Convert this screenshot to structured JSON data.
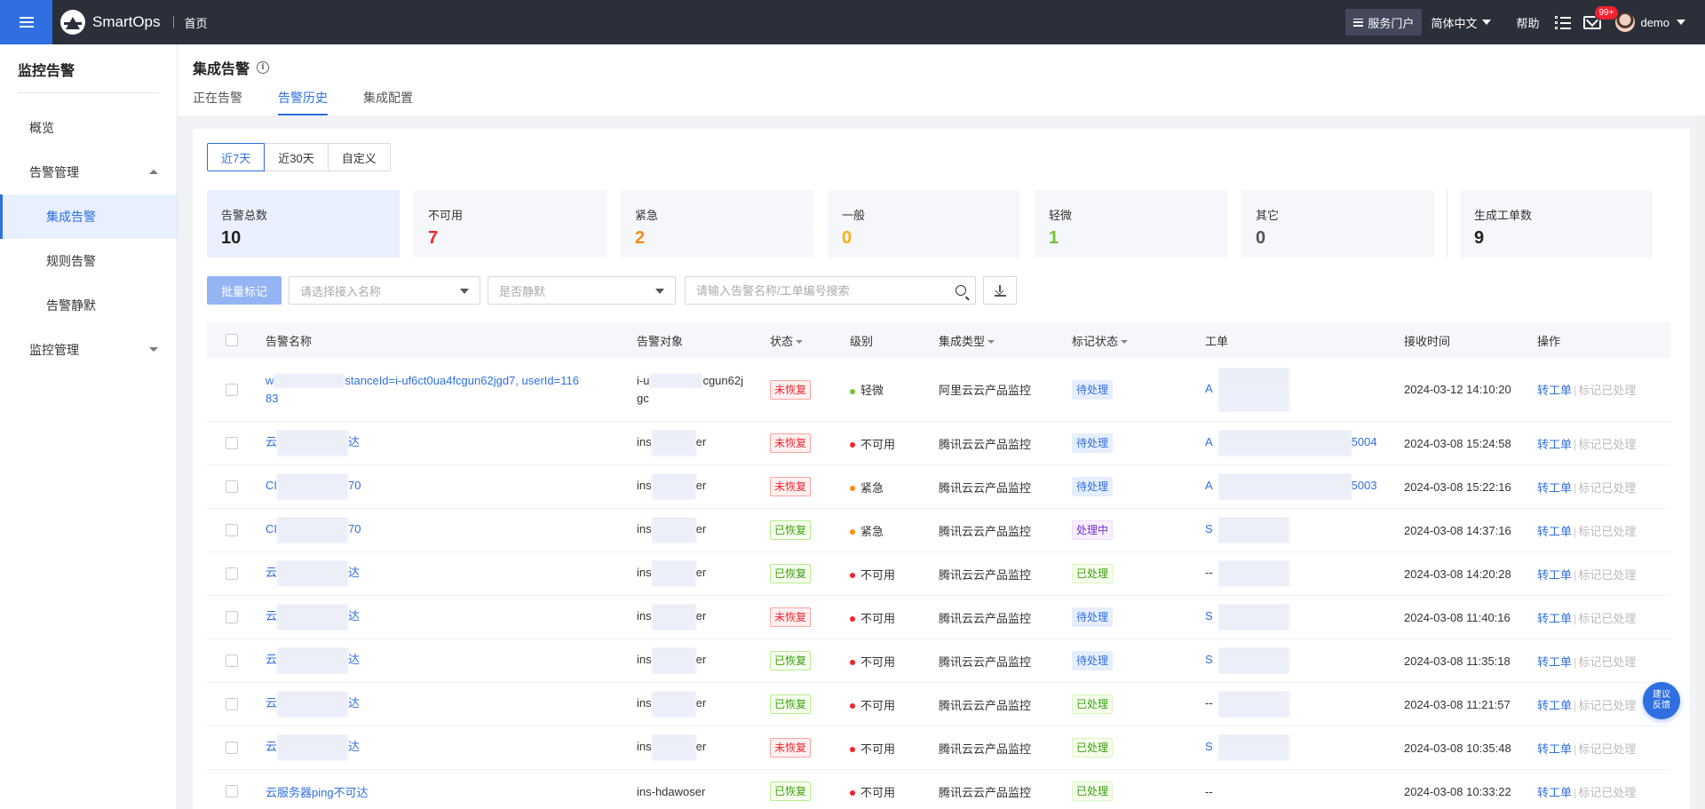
{
  "header": {
    "logo_text": "SmartOps",
    "home_link": "首页",
    "portal_label": "服务门户",
    "lang_label": "简体中文",
    "help_label": "帮助",
    "mail_badge": "99+",
    "username": "demo"
  },
  "sidebar": {
    "title": "监控告警",
    "items": [
      {
        "label": "概览"
      },
      {
        "label": "告警管理"
      },
      {
        "label": "集成告警"
      },
      {
        "label": "规则告警"
      },
      {
        "label": "告警静默"
      },
      {
        "label": "监控管理"
      }
    ]
  },
  "page": {
    "title": "集成告警",
    "tabs": [
      {
        "label": "正在告警"
      },
      {
        "label": "告警历史"
      },
      {
        "label": "集成配置"
      }
    ]
  },
  "range": [
    "近7天",
    "近30天",
    "自定义"
  ],
  "stats": [
    {
      "label": "告警总数",
      "value": "10",
      "color": "#222222"
    },
    {
      "label": "不可用",
      "value": "7",
      "color": "#f5222d"
    },
    {
      "label": "紧急",
      "value": "2",
      "color": "#fa8c16"
    },
    {
      "label": "一般",
      "value": "0",
      "color": "#faad14"
    },
    {
      "label": "轻微",
      "value": "1",
      "color": "#73c23a"
    },
    {
      "label": "其它",
      "value": "0",
      "color": "#555555"
    },
    {
      "label": "生成工单数",
      "value": "9",
      "color": "#222222"
    }
  ],
  "filters": {
    "batch_label": "批量标记",
    "integration_placeholder": "请选择接入名称",
    "silence_placeholder": "是否静默",
    "search_placeholder": "请输入告警名称/工单编号搜索"
  },
  "table": {
    "headers": {
      "name": "告警名称",
      "object": "告警对象",
      "status": "状态",
      "level": "级别",
      "integration": "集成类型",
      "mark": "标记状态",
      "ticket": "工单",
      "time": "接收时间",
      "ops": "操作"
    },
    "ops_labels": {
      "ticket": "转工单",
      "mark": "标记已处理"
    },
    "rows": [
      {
        "name_a": "w",
        "name_b": "stanceId=i-uf6ct0ua4fcgun62jgd7, userId=116",
        "name_c": "83",
        "obj_a": "i-u",
        "obj_b": "cgun62j",
        "obj_c": "gc",
        "status": "未恢复",
        "level": "轻微",
        "level_color": "#73c23a",
        "integration": "阿里云云产品监控",
        "mark": "待处理",
        "ticket_a": "A",
        "ticket_b": "",
        "time": "2024-03-12 14:10:20"
      },
      {
        "name_a": "云",
        "name_b": "达",
        "obj_a": "ins",
        "obj_b": "er",
        "status": "未恢复",
        "level": "不可用",
        "level_color": "#f5222d",
        "integration": "腾讯云云产品监控",
        "mark": "待处理",
        "ticket_a": "A",
        "ticket_b": "5004",
        "time": "2024-03-08 15:24:58"
      },
      {
        "name_a": "CI",
        "name_b": "70",
        "obj_a": "ins",
        "obj_b": "er",
        "status": "未恢复",
        "level": "紧急",
        "level_color": "#fa8c16",
        "integration": "腾讯云云产品监控",
        "mark": "待处理",
        "ticket_a": "A",
        "ticket_b": "5003",
        "time": "2024-03-08 15:22:16"
      },
      {
        "name_a": "CI",
        "name_b": "70",
        "obj_a": "ins",
        "obj_b": "er",
        "status": "已恢复",
        "level": "紧急",
        "level_color": "#fa8c16",
        "integration": "腾讯云云产品监控",
        "mark": "处理中",
        "ticket_a": "S",
        "ticket_b": "",
        "time": "2024-03-08 14:37:16"
      },
      {
        "name_a": "云",
        "name_b": "达",
        "obj_a": "ins",
        "obj_b": "er",
        "status": "已恢复",
        "level": "不可用",
        "level_color": "#f5222d",
        "integration": "腾讯云云产品监控",
        "mark": "已处理",
        "ticket_a": "--",
        "ticket_b": "",
        "time": "2024-03-08 14:20:28"
      },
      {
        "name_a": "云",
        "name_b": "达",
        "obj_a": "ins",
        "obj_b": "er",
        "status": "未恢复",
        "level": "不可用",
        "level_color": "#f5222d",
        "integration": "腾讯云云产品监控",
        "mark": "待处理",
        "ticket_a": "S",
        "ticket_b": "",
        "time": "2024-03-08 11:40:16"
      },
      {
        "name_a": "云",
        "name_b": "达",
        "obj_a": "ins",
        "obj_b": "er",
        "status": "已恢复",
        "level": "不可用",
        "level_color": "#f5222d",
        "integration": "腾讯云云产品监控",
        "mark": "待处理",
        "ticket_a": "S",
        "ticket_b": "",
        "time": "2024-03-08 11:35:18"
      },
      {
        "name_a": "云",
        "name_b": "达",
        "obj_a": "ins",
        "obj_b": "er",
        "status": "已恢复",
        "level": "不可用",
        "level_color": "#f5222d",
        "integration": "腾讯云云产品监控",
        "mark": "已处理",
        "ticket_a": "--",
        "ticket_b": "",
        "time": "2024-03-08 11:21:57"
      },
      {
        "name_a": "云",
        "name_b": "达",
        "obj_a": "ins",
        "obj_b": "er",
        "status": "未恢复",
        "level": "不可用",
        "level_color": "#f5222d",
        "integration": "腾讯云云产品监控",
        "mark": "已处理",
        "ticket_a": "S",
        "ticket_b": "",
        "time": "2024-03-08 10:35:48"
      },
      {
        "name_a": "云服务器ping不可达",
        "name_b": "",
        "obj_a": "ins-hdawoser",
        "obj_b": "",
        "status": "已恢复",
        "level": "不可用",
        "level_color": "#f5222d",
        "integration": "腾讯云云产品监控",
        "mark": "已处理",
        "ticket_a": "--",
        "ticket_b": "",
        "time": "2024-03-08 10:33:22"
      }
    ]
  },
  "feedback": {
    "line1": "建议",
    "line2": "反馈"
  },
  "colors": {
    "accent": "#2f6fe0",
    "topbar": "#2b2f3a"
  }
}
